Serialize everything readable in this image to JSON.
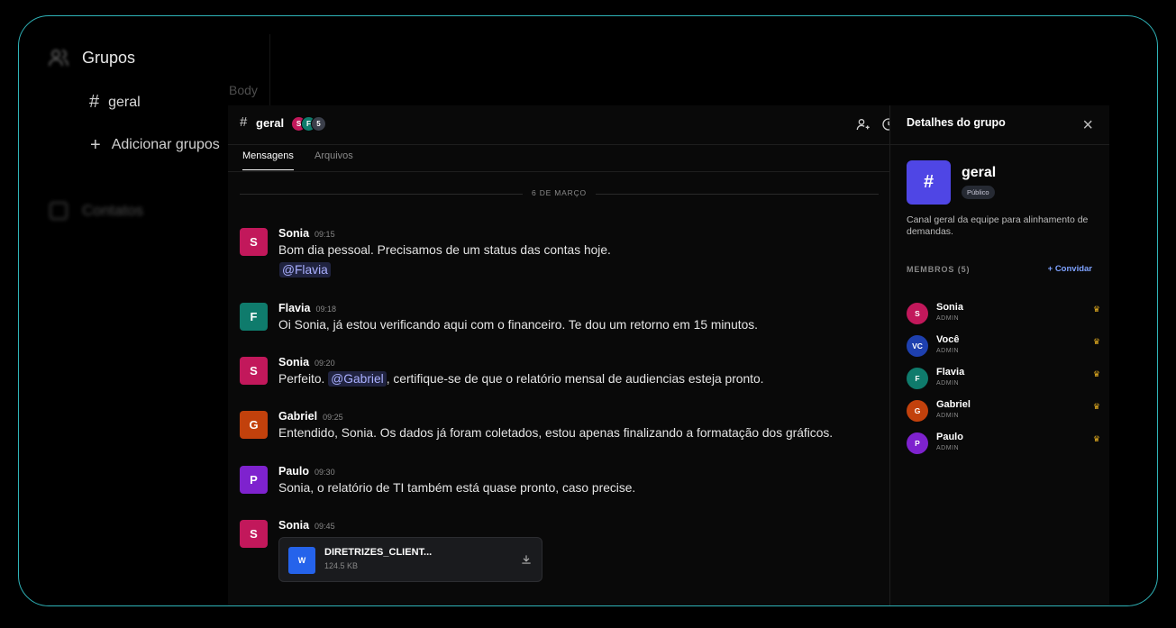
{
  "sidebar": {
    "title": "Grupos",
    "channel": "geral",
    "add_label": "Adicionar grupos",
    "contacts_label": "Contatos",
    "body_label": "Body"
  },
  "header": {
    "channel_name": "geral",
    "avatar_stack": [
      "S",
      "F",
      "5"
    ]
  },
  "tabs": [
    "Mensagens",
    "Arquivos"
  ],
  "date_divider": "6 DE MARÇO",
  "messages": [
    {
      "initial": "S",
      "author": "Sonia",
      "time": "09:15",
      "text": "Bom dia pessoal. Precisamos de um status das contas hoje.",
      "mention": "@Flavia",
      "color": "#c2185b"
    },
    {
      "initial": "F",
      "author": "Flavia",
      "time": "09:18",
      "text": "Oi Sonia, já estou verificando aqui com o financeiro. Te dou um retorno em 15 minutos.",
      "color": "#0f7b6c"
    },
    {
      "initial": "S",
      "author": "Sonia",
      "time": "09:20",
      "text_before": "Perfeito.",
      "mention": "@Gabriel",
      "text_after": ", certifique-se de que o relatório mensal de audiencias esteja pronto.",
      "color": "#c2185b"
    },
    {
      "initial": "G",
      "author": "Gabriel",
      "time": "09:25",
      "text": "Entendido, Sonia. Os dados já foram coletados, estou apenas finalizando a formatação dos gráficos.",
      "color": "#c2410c"
    },
    {
      "initial": "P",
      "author": "Paulo",
      "time": "09:30",
      "text": "Sonia, o relatório de TI também está quase pronto, caso precise.",
      "color": "#7e22ce"
    },
    {
      "initial": "S",
      "author": "Sonia",
      "time": "09:45",
      "color": "#c2185b",
      "file": {
        "type": "W",
        "name": "DIRETRIZES_CLIENT...",
        "size": "124.5 KB"
      }
    }
  ],
  "details": {
    "title": "Detalhes do grupo",
    "group_name": "geral",
    "badge": "Público",
    "description": "Canal geral da equipe para alinhamento de demandas.",
    "members_header": "MEMBROS (5)",
    "invite_label": "Convidar",
    "members": [
      {
        "initials": "S",
        "name": "Sonia",
        "role": "ADMIN",
        "color": "#c2185b"
      },
      {
        "initials": "VC",
        "name": "Você",
        "role": "ADMIN",
        "color": "#1e40af"
      },
      {
        "initials": "F",
        "name": "Flavia",
        "role": "ADMIN",
        "color": "#0f7b6c"
      },
      {
        "initials": "G",
        "name": "Gabriel",
        "role": "ADMIN",
        "color": "#c2410c"
      },
      {
        "initials": "P",
        "name": "Paulo",
        "role": "ADMIN",
        "color": "#7e22ce"
      }
    ]
  }
}
